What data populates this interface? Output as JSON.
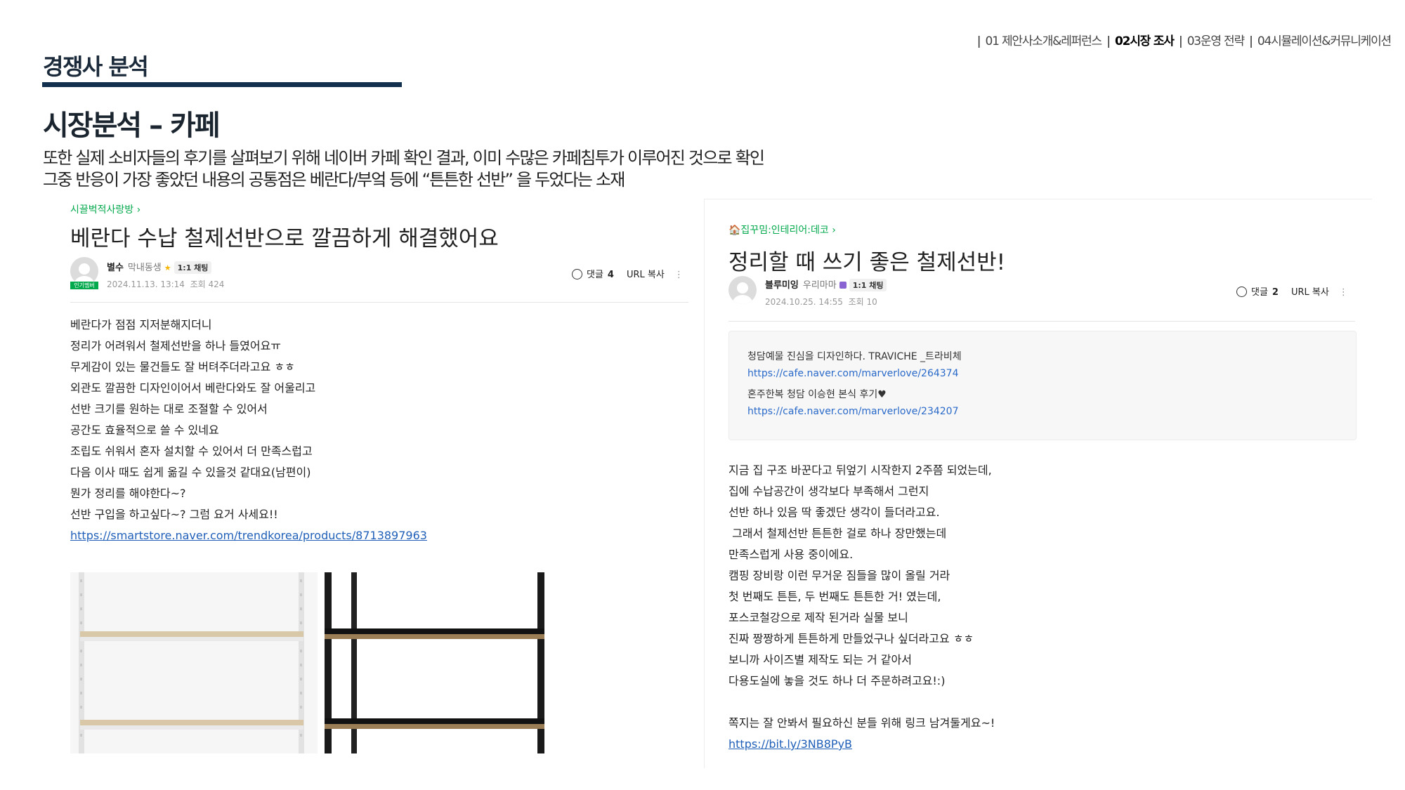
{
  "nav": {
    "items": [
      "01 제안사소개&레퍼런스",
      "02시장 조사",
      "03운영 전략",
      "04시뮬레이션&커뮤니케이션"
    ],
    "active_index": 1
  },
  "section_title": "경쟁사 분석",
  "main_title": "시장분석 – 카페",
  "description": [
    "또한 실제 소비자들의 후기를 살펴보기 위해 네이버 카페 확인 결과, 이미 수많은 카페침투가 이루어진 것으로 확인",
    "그중 반응이 가장 좋았던  내용의 공통점은 베란다/부엌 등에 “튼튼한 선반” 을 두었다는 소재"
  ],
  "post1": {
    "board": "시끌벅적사랑방",
    "title": "베란다 수납 철제선반으로 깔끔하게 해결했어요",
    "popular_badge": "인기멤버",
    "author": "별수",
    "grade": "막내동생",
    "chat": "1:1 채팅",
    "date": "2024.11.13. 13:14",
    "views": "조회 424",
    "comments_label": "댓글",
    "comments_count": "4",
    "url_copy": "URL 복사",
    "lines": [
      "베란다가 점점 지저분해지더니",
      "정리가 어려워서 철제선반을 하나 들였어요ㅠ",
      "무게감이 있는 물건들도 잘 버텨주더라고요 ㅎㅎ",
      "외관도 깔끔한 디자인이어서 베란다와도 잘 어울리고",
      "선반 크기를 원하는 대로 조절할 수 있어서",
      "공간도 효율적으로 쓸 수 있네요",
      "조립도 쉬워서 혼자 설치할 수 있어서 더 만족스럽고",
      "다음 이사 때도 쉽게 옮길 수 있을것 같대요(남편이)",
      "뭔가 정리를 해야한다~?",
      "선반 구입을 하고싶다~? 그럼 요거 사세요!!"
    ],
    "link": "https://smartstore.naver.com/trendkorea/products/8713897963"
  },
  "post2": {
    "board": "🏠집꾸밈:인테리어:데코",
    "title": "정리할 때 쓰기 좋은 철제선반!",
    "author": "블루미잉",
    "grade": "우리마마",
    "chat": "1:1 채팅",
    "date": "2024.10.25. 14:55",
    "views": "조회 10",
    "comments_label": "댓글",
    "comments_count": "2",
    "url_copy": "URL 복사",
    "quote": {
      "line1": "청담예물 진심을 디자인하다. TRAVICHE _트라비체",
      "link1": "https://cafe.naver.com/marverlove/264374",
      "line2": "혼주한복 청담 이승현 본식 후기♥",
      "link2": "https://cafe.naver.com/marverlove/234207"
    },
    "lines": [
      "지금 집 구조 바꾼다고 뒤엎기 시작한지 2주쯤 되었는데,",
      "집에 수납공간이 생각보다 부족해서 그런지",
      "선반 하나 있음 딱 좋겠단 생각이 들더라고요.",
      " 그래서 철제선반 튼튼한 걸로 하나 장만했는데",
      "만족스럽게 사용 중이에요.",
      "캠핑 장비랑 이런 무거운 짐들을 많이 올릴 거라",
      "첫 번째도 튼튼, 두 번째도 튼튼한 거! 였는데,",
      "포스코철강으로 제작 된거라 실물 보니",
      "진짜 짱짱하게 튼튼하게 만들었구나 싶더라고요 ㅎㅎ",
      "보니까 사이즈별 제작도 되는 거 같아서",
      "다용도실에 놓을 것도 하나 더 주문하려고요!:)"
    ],
    "closing": "쪽지는 잘 안봐서 필요하신 분들 위해 링크 남겨둘게요~!",
    "link": "https://bit.ly/3NB8PyB"
  }
}
